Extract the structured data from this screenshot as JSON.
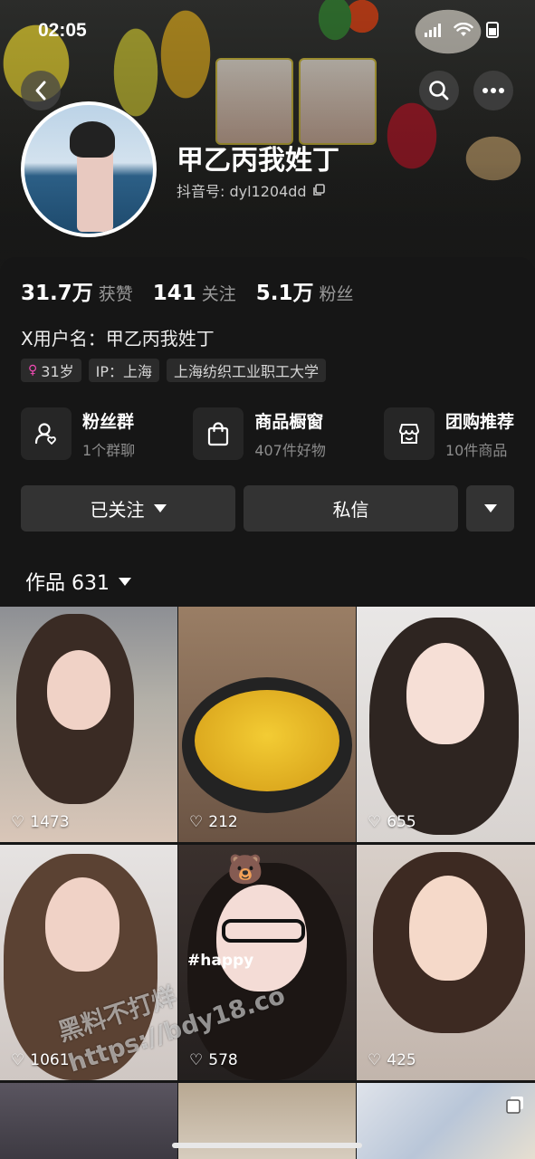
{
  "status_bar": {
    "time": "02:05"
  },
  "header": {
    "display_name": "甲乙丙我姓丁",
    "douyin_id": "抖音号: dyl1204dd"
  },
  "stats": [
    {
      "value": "31.7万",
      "label": "获赞"
    },
    {
      "value": "141",
      "label": "关注"
    },
    {
      "value": "5.1万",
      "label": "粉丝"
    }
  ],
  "bio": "X用户名：甲乙丙我姓丁",
  "tags": {
    "age": "31岁",
    "ip": "IP：上海",
    "school": "上海纺织工业职工大学"
  },
  "features": [
    {
      "icon": "fan-group-icon",
      "title": "粉丝群",
      "subtitle": "1个群聊"
    },
    {
      "icon": "shopping-bag-icon",
      "title": "商品橱窗",
      "subtitle": "407件好物"
    },
    {
      "icon": "store-icon",
      "title": "团购推荐",
      "subtitle": "10件商品"
    }
  ],
  "actions": {
    "follow": "已关注",
    "message": "私信"
  },
  "works": {
    "label": "作品 631"
  },
  "videos": [
    {
      "likes": "1473"
    },
    {
      "likes": "212"
    },
    {
      "likes": "655"
    },
    {
      "likes": "1061"
    },
    {
      "likes": "578",
      "overlay_text": "#happy"
    },
    {
      "likes": "425"
    }
  ],
  "watermark": {
    "line1": "黑料不打烊",
    "line2": "https://bdy18.co"
  },
  "colors": {
    "background": "#161616",
    "button": "#333333",
    "tag": "#2b2b2b",
    "female_accent": "#f14ab4"
  }
}
